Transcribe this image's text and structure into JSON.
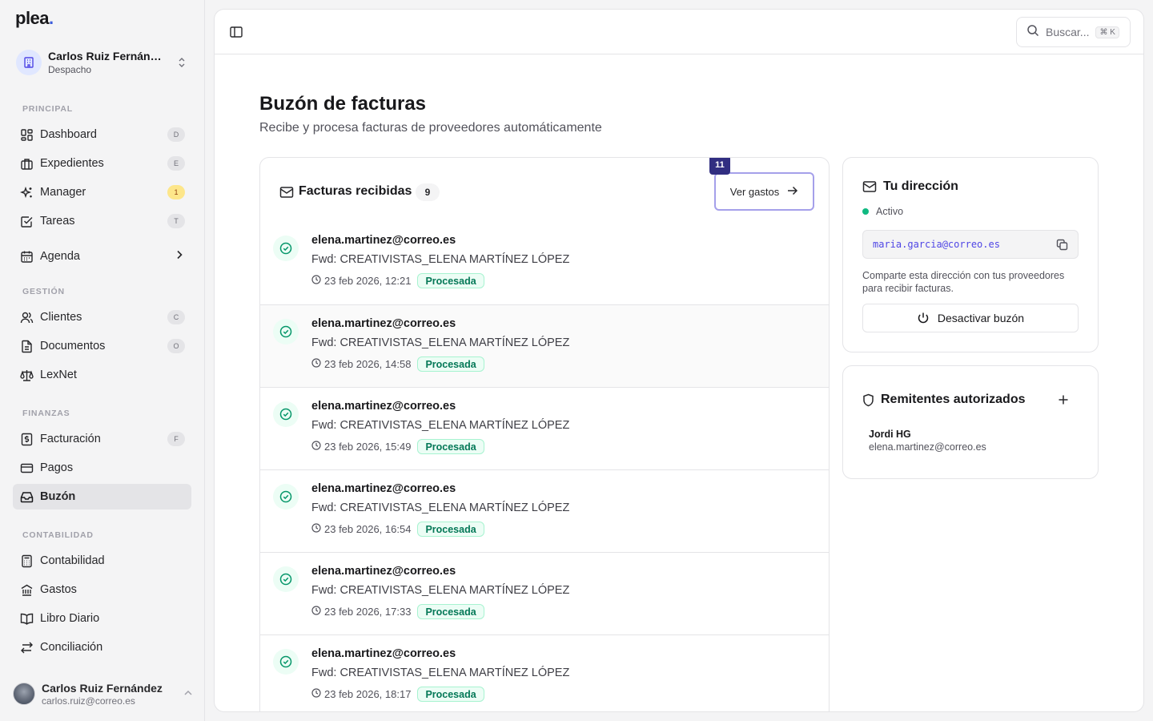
{
  "brand": {
    "name": "plea",
    "dot": "."
  },
  "org": {
    "name": "Carlos Ruiz Fernández",
    "role": "Despacho"
  },
  "sidebar": {
    "sections": {
      "principal": "PRINCIPAL",
      "gestion": "GESTIÓN",
      "finanzas": "FINANZAS",
      "contabilidad": "CONTABILIDAD"
    },
    "items": {
      "dashboard": {
        "label": "Dashboard",
        "shortcut": "D"
      },
      "expedientes": {
        "label": "Expedientes",
        "shortcut": "E"
      },
      "manager": {
        "label": "Manager",
        "badge": "1"
      },
      "tareas": {
        "label": "Tareas",
        "shortcut": "T"
      },
      "agenda": {
        "label": "Agenda"
      },
      "clientes": {
        "label": "Clientes",
        "shortcut": "C"
      },
      "documentos": {
        "label": "Documentos",
        "shortcut": "O"
      },
      "lexnet": {
        "label": "LexNet"
      },
      "facturacion": {
        "label": "Facturación",
        "shortcut": "F"
      },
      "pagos": {
        "label": "Pagos"
      },
      "buzon": {
        "label": "Buzón"
      },
      "contabilidad": {
        "label": "Contabilidad"
      },
      "gastos": {
        "label": "Gastos"
      },
      "libro_diario": {
        "label": "Libro Diario"
      },
      "conciliacion": {
        "label": "Conciliación"
      }
    }
  },
  "user": {
    "name": "Carlos Ruiz Fernández",
    "email": "carlos.ruiz@correo.es"
  },
  "search": {
    "placeholder": "Buscar...",
    "shortcut": "⌘ K"
  },
  "page": {
    "title": "Buzón de facturas",
    "subtitle": "Recibe y procesa facturas de proveedores automáticamente"
  },
  "inbox": {
    "title": "Facturas recibidas",
    "count": "9",
    "ver_gastos": "Ver gastos",
    "step_badge": "11",
    "rows": [
      {
        "from": "elena.martinez@correo.es",
        "subject": "Fwd: CREATIVISTAS_ELENA MARTÍNEZ LÓPEZ",
        "date": "23 feb 2026, 12:21",
        "status": "Procesada"
      },
      {
        "from": "elena.martinez@correo.es",
        "subject": "Fwd: CREATIVISTAS_ELENA MARTÍNEZ LÓPEZ",
        "date": "23 feb 2026, 14:58",
        "status": "Procesada"
      },
      {
        "from": "elena.martinez@correo.es",
        "subject": "Fwd: CREATIVISTAS_ELENA MARTÍNEZ LÓPEZ",
        "date": "23 feb 2026, 15:49",
        "status": "Procesada"
      },
      {
        "from": "elena.martinez@correo.es",
        "subject": "Fwd: CREATIVISTAS_ELENA MARTÍNEZ LÓPEZ",
        "date": "23 feb 2026, 16:54",
        "status": "Procesada"
      },
      {
        "from": "elena.martinez@correo.es",
        "subject": "Fwd: CREATIVISTAS_ELENA MARTÍNEZ LÓPEZ",
        "date": "23 feb 2026, 17:33",
        "status": "Procesada"
      },
      {
        "from": "elena.martinez@correo.es",
        "subject": "Fwd: CREATIVISTAS_ELENA MARTÍNEZ LÓPEZ",
        "date": "23 feb 2026, 18:17",
        "status": "Procesada"
      }
    ]
  },
  "address": {
    "title": "Tu dirección",
    "status": "Activo",
    "email": "maria.garcia@correo.es",
    "help": "Comparte esta dirección con tus proveedores para recibir facturas.",
    "deactivate": "Desactivar buzón"
  },
  "senders": {
    "title": "Remitentes autorizados",
    "items": [
      {
        "name": "Jordi HG",
        "email": "elena.martinez@correo.es"
      }
    ]
  },
  "colors": {
    "accent": "#3b5bdb",
    "success": "#047857",
    "step": "#312e81"
  }
}
